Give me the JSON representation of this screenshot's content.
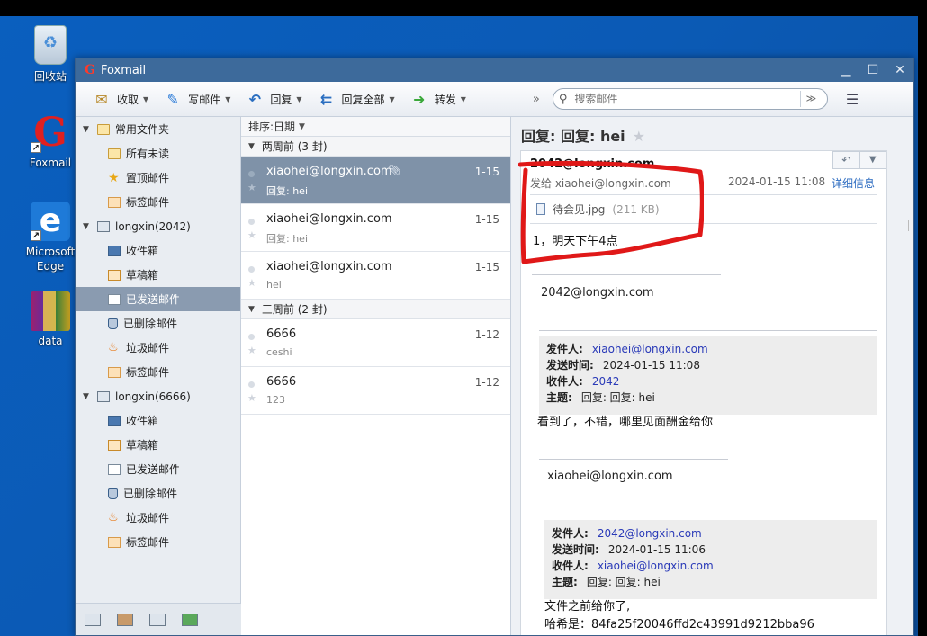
{
  "desktop": {
    "icons": [
      {
        "label": "回收站"
      },
      {
        "label": "Foxmail"
      },
      {
        "label": "Microsoft Edge"
      },
      {
        "label": "data"
      }
    ]
  },
  "window": {
    "title": "Foxmail",
    "controls": {
      "minimize": "▁",
      "maximize": "☐",
      "close": "✕"
    }
  },
  "toolbar": {
    "receive": "收取",
    "write": "写邮件",
    "reply": "回复",
    "reply_all": "回复全部",
    "forward": "转发",
    "more": "»",
    "search_placeholder": "搜索邮件"
  },
  "sidebar": {
    "common_folder": "常用文件夹",
    "common_items": [
      "所有未读",
      "置顶邮件",
      "标签邮件"
    ],
    "accounts": [
      {
        "name": "longxin(2042)",
        "items": [
          "收件箱",
          "草稿箱",
          "已发送邮件",
          "已删除邮件",
          "垃圾邮件",
          "标签邮件"
        ]
      },
      {
        "name": "longxin(6666)",
        "items": [
          "收件箱",
          "草稿箱",
          "已发送邮件",
          "已删除邮件",
          "垃圾邮件",
          "标签邮件"
        ]
      }
    ],
    "selected": "longxin(2042)/已发送邮件"
  },
  "maillist": {
    "sort_label": "排序:日期",
    "groups": [
      {
        "label": "两周前 (3 封)",
        "mails": [
          {
            "from": "xiaohei@longxin.com",
            "subject": "回复: hei",
            "date": "1-15",
            "attachment": true,
            "selected": true
          },
          {
            "from": "xiaohei@longxin.com",
            "subject": "回复: hei",
            "date": "1-15"
          },
          {
            "from": "xiaohei@longxin.com",
            "subject": "hei",
            "date": "1-15"
          }
        ]
      },
      {
        "label": "三周前 (2 封)",
        "mails": [
          {
            "from": "6666",
            "subject": "ceshi",
            "date": "1-12"
          },
          {
            "from": "6666",
            "subject": "123",
            "date": "1-12"
          }
        ]
      }
    ]
  },
  "reader": {
    "title": "回复: 回复: hei",
    "sender": "2042@longxin.com",
    "to_line": "发给 xiaohei@longxin.com",
    "date": "2024-01-15 11:08",
    "details_link": "详细信息",
    "attachment_name": "待会见.jpg",
    "attachment_size": "(211 KB)",
    "body_first": "1，明天下午4点",
    "quote1": {
      "name": "2042@longxin.com",
      "from_label": "发件人:",
      "from": "xiaohei@longxin.com",
      "time_label": "发送时间:",
      "time": "2024-01-15 11:08",
      "to_label": "收件人:",
      "to": "2042",
      "subject_label": "主题:",
      "subject": "回复: 回复: hei",
      "text": "看到了，不错，哪里见面酬金给你"
    },
    "quote2": {
      "name": "xiaohei@longxin.com",
      "from_label": "发件人:",
      "from": "2042@longxin.com",
      "time_label": "发送时间:",
      "time": "2024-01-15 11:06",
      "to_label": "收件人:",
      "to": "xiaohei@longxin.com",
      "subject_label": "主题:",
      "subject": "回复: 回复: hei",
      "text1": "文件之前给你了,",
      "text2": "哈希是：84fa25f20046ffd2c43991d9212bba96"
    }
  },
  "colors": {
    "desktop": "#0b5ab5",
    "titlebar": "#3d6a9b",
    "selected_row": "#7f92a8",
    "annotation": "#e01818"
  }
}
